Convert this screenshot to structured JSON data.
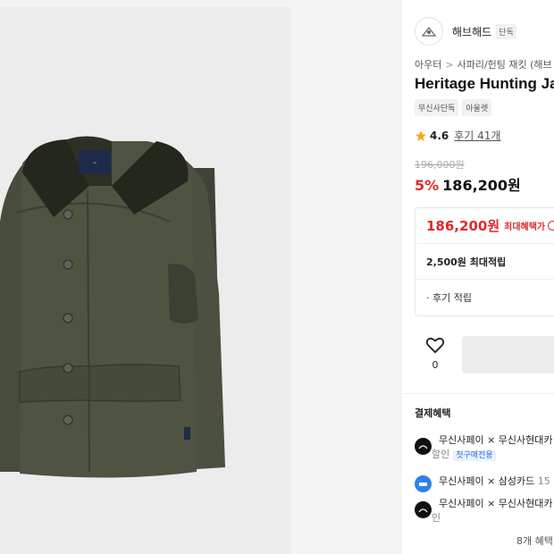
{
  "brand": {
    "name": "해브해드",
    "badge": "단독",
    "logo_icon": "brand-emblem-icon"
  },
  "breadcrumb": {
    "level1": "아우터",
    "level2": "사파리/헌팅 재킷 (해브"
  },
  "product": {
    "title": "Heritage Hunting Jac",
    "image_alt": "olive green hunting jacket with corduroy collar"
  },
  "tags": [
    "무신사단독",
    "아울렛"
  ],
  "rating": {
    "value": "4.6",
    "review_link": "후기 41개"
  },
  "price": {
    "original": "196,000원",
    "discount": "5%",
    "sale": "186,200원"
  },
  "benefit": {
    "max_price": "186,200원",
    "max_label": "최대혜택가",
    "points": "2,500원 최대적립",
    "review_points": "· 후기 적립"
  },
  "like": {
    "count": "0"
  },
  "payment": {
    "title": "결제혜택",
    "items": [
      {
        "line1": "무신사페이 × 무신사현대카",
        "line2": "할인",
        "badge": "첫구매전용"
      },
      {
        "line1": "무신사페이 × 삼성카드",
        "more": "15",
        "line2": ""
      },
      {
        "line1": "무신사페이 × 무신사현대카",
        "line2": "인"
      }
    ],
    "more": "8개 혜택"
  },
  "colors": {
    "accent_red": "#e0292b",
    "jacket_green": "#4c5140",
    "collar": "#22261d",
    "badge_blue": "#2f6fd6"
  }
}
